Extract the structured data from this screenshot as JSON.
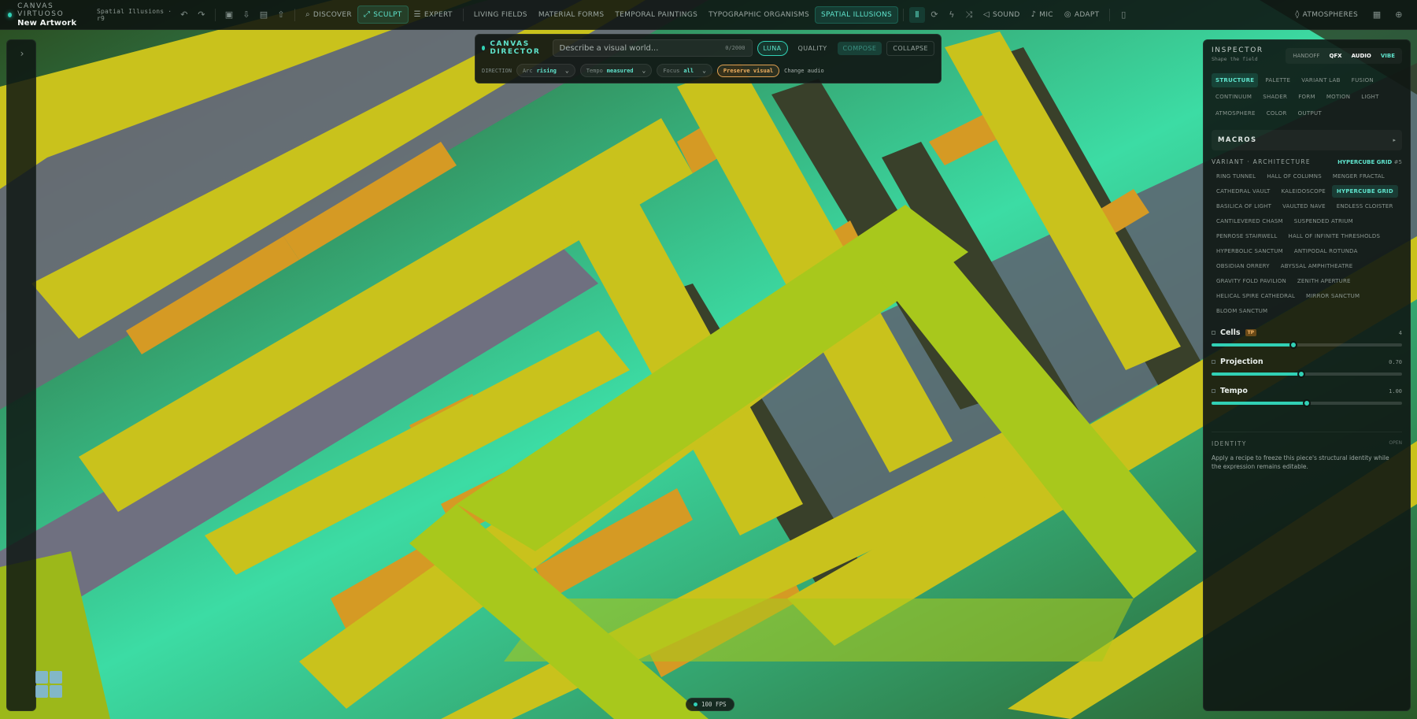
{
  "app": {
    "brand": "CANVAS VIRTUOSO",
    "artwork": "New Artwork",
    "project": "Spatial Illusions · r9"
  },
  "toolbar": {
    "discover": "DISCOVER",
    "sculpt": "SCULPT",
    "expert": "EXPERT",
    "categories": [
      "LIVING FIELDS",
      "MATERIAL FORMS",
      "TEMPORAL PAINTINGS",
      "TYPOGRAPHIC ORGANISMS",
      "SPATIAL ILLUSIONS"
    ],
    "sound": "SOUND",
    "mic": "MIC",
    "adapt": "ADAPT",
    "atmospheres": "ATMOSPHERES"
  },
  "director": {
    "title": "CANVAS DIRECTOR",
    "placeholder": "Describe a visual world...",
    "counter": "0/2000",
    "luna": "LUNA",
    "quality": "QUALITY",
    "compose": "COMPOSE",
    "collapse": "COLLAPSE",
    "direction_label": "DIRECTION",
    "arc_label": "Arc",
    "arc_value": "rising",
    "tempo_label": "Tempo",
    "tempo_value": "measured",
    "focus_label": "Focus",
    "focus_value": "all",
    "preserve": "Preserve visual",
    "change_audio": "Change audio"
  },
  "inspector": {
    "title": "INSPECTOR",
    "subtitle": "Shape the field",
    "modes": [
      "HANDOFF",
      "QFX",
      "AUDIO",
      "VIBE"
    ],
    "tabs": [
      "STRUCTURE",
      "PALETTE",
      "VARIANT LAB",
      "FUSION",
      "CONTINUUM",
      "SHADER",
      "FORM",
      "MOTION",
      "LIGHT",
      "ATMOSPHERE",
      "COLOR",
      "OUTPUT"
    ],
    "macros": "MACROS",
    "variant_title": "VARIANT · ARCHITECTURE",
    "variant_selected": "HYPERCUBE GRID",
    "variant_index": "#5",
    "variants": [
      "RING TUNNEL",
      "HALL OF COLUMNS",
      "MENGER FRACTAL",
      "CATHEDRAL VAULT",
      "KALEIDOSCOPE",
      "HYPERCUBE GRID",
      "BASILICA OF LIGHT",
      "VAULTED NAVE",
      "ENDLESS CLOISTER",
      "CANTILEVERED CHASM",
      "SUSPENDED ATRIUM",
      "PENROSE STAIRWELL",
      "HALL OF INFINITE THRESHOLDS",
      "HYPERBOLIC SANCTUM",
      "ANTIPODAL ROTUNDA",
      "OBSIDIAN ORRERY",
      "ABYSSAL AMPHITHEATRE",
      "GRAVITY FOLD PAVILION",
      "ZENITH APERTURE",
      "HELICAL SPIRE CATHEDRAL",
      "MIRROR SANCTUM",
      "BLOOM SANCTUM"
    ],
    "sliders": [
      {
        "name": "Cells",
        "badge": "TP",
        "value": "4",
        "fraction": 0.43
      },
      {
        "name": "Projection",
        "badge": "",
        "value": "0.70",
        "fraction": 0.47
      },
      {
        "name": "Tempo",
        "badge": "",
        "value": "1.00",
        "fraction": 0.5
      }
    ],
    "identity_title": "IDENTITY",
    "identity_tag": "OPEN",
    "identity_text": "Apply a recipe to freeze this piece's structural identity while the expression remains editable."
  },
  "status": {
    "fps": "100 FPS"
  },
  "colors": {
    "accent": "#31d0b5",
    "beam": "#c9c21c",
    "background_glow": "#3ee0a8",
    "bar": "#d59a24",
    "shadow": "#6b6c78"
  }
}
